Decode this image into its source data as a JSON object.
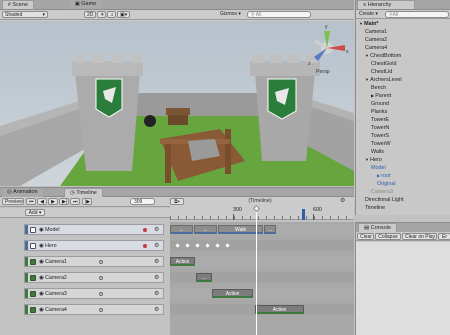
{
  "scene_panel": {
    "tabs": [
      "Scene",
      "Game"
    ],
    "shading_mode": "Shaded",
    "mode_2d": "2D",
    "gizmos_label": "Gizmos",
    "search_placeholder": "All",
    "persp_label": "Persp",
    "gizmo_axes": [
      "y",
      "x",
      "z"
    ]
  },
  "hierarchy": {
    "tab": "Hierarchy",
    "create_label": "Create",
    "search_placeholder": "All",
    "items": [
      {
        "label": "Main*",
        "depth": 0,
        "arrow": "▼",
        "color": "#1e1e1e",
        "bold": true
      },
      {
        "label": "Camera1",
        "depth": 1,
        "arrow": "",
        "color": "#1e1e1e"
      },
      {
        "label": "Camera2",
        "depth": 1,
        "arrow": "",
        "color": "#1e1e1e"
      },
      {
        "label": "Camera4",
        "depth": 1,
        "arrow": "",
        "color": "#1e1e1e"
      },
      {
        "label": "ChestBottom",
        "depth": 1,
        "arrow": "▼",
        "color": "#1e1e1e"
      },
      {
        "label": "ChestGold",
        "depth": 2,
        "arrow": "",
        "color": "#1e1e1e"
      },
      {
        "label": "ChestLid",
        "depth": 2,
        "arrow": "",
        "color": "#1e1e1e"
      },
      {
        "label": "ArchersLevel",
        "depth": 1,
        "arrow": "▼",
        "color": "#1e1e1e"
      },
      {
        "label": "Bench",
        "depth": 2,
        "arrow": "",
        "color": "#1e1e1e"
      },
      {
        "label": "Parent",
        "depth": 2,
        "arrow": "▶",
        "color": "#1e1e1e"
      },
      {
        "label": "Ground",
        "depth": 2,
        "arrow": "",
        "color": "#1e1e1e"
      },
      {
        "label": "Planks",
        "depth": 2,
        "arrow": "",
        "color": "#1e1e1e"
      },
      {
        "label": "TowerE",
        "depth": 2,
        "arrow": "",
        "color": "#1e1e1e"
      },
      {
        "label": "TowerN",
        "depth": 2,
        "arrow": "",
        "color": "#1e1e1e"
      },
      {
        "label": "TowerS",
        "depth": 2,
        "arrow": "",
        "color": "#1e1e1e"
      },
      {
        "label": "TowerW",
        "depth": 2,
        "arrow": "",
        "color": "#1e1e1e"
      },
      {
        "label": "Walls",
        "depth": 2,
        "arrow": "",
        "color": "#1e1e1e"
      },
      {
        "label": "Hero",
        "depth": 1,
        "arrow": "▼",
        "color": "#1e1e1e"
      },
      {
        "label": "Model",
        "depth": 2,
        "arrow": "",
        "color": "#2f5da8"
      },
      {
        "label": "root",
        "depth": 3,
        "arrow": "▶",
        "color": "#2f5da8"
      },
      {
        "label": "Original",
        "depth": 3,
        "arrow": "",
        "color": "#2f5da8"
      },
      {
        "label": "Camera3",
        "depth": 2,
        "arrow": "",
        "color": "#8a8a8a"
      },
      {
        "label": "Directional Light",
        "depth": 1,
        "arrow": "",
        "color": "#1e1e1e"
      },
      {
        "label": "Timeline",
        "depth": 1,
        "arrow": "",
        "color": "#1e1e1e"
      }
    ]
  },
  "timeline_panel": {
    "tabs": [
      "Animation",
      "Timeline"
    ],
    "preview_label": "Preview",
    "frame_value": "309",
    "timeline_name": "(Timeline)",
    "add_label": "Add",
    "ruler_labels": [
      "300",
      "600"
    ],
    "tracks": [
      {
        "name": "Model",
        "kind": "anim",
        "strip": "#4b6d9c",
        "dot": "#c43b3b"
      },
      {
        "name": "Hero",
        "kind": "anim",
        "strip": "#4b6d9c",
        "dot": "#c43b3b"
      },
      {
        "name": "Camera1",
        "kind": "act",
        "strip": "#3f7a3f",
        "dot": ""
      },
      {
        "name": "Camera2",
        "kind": "act",
        "strip": "#3f7a3f",
        "dot": ""
      },
      {
        "name": "Camera3",
        "kind": "act",
        "strip": "#3f7a3f",
        "dot": ""
      },
      {
        "name": "Camera4",
        "kind": "act",
        "strip": "#3f7a3f",
        "dot": ""
      }
    ],
    "clips": [
      {
        "track": 0,
        "label": "...",
        "kind": "anim",
        "start": 0.0,
        "end": 0.13
      },
      {
        "track": 0,
        "label": "...",
        "kind": "anim",
        "start": 0.13,
        "end": 0.26
      },
      {
        "track": 0,
        "label": "Walk",
        "kind": "anim",
        "start": 0.26,
        "end": 0.51
      },
      {
        "track": 0,
        "label": "...",
        "kind": "anim",
        "start": 0.51,
        "end": 0.58
      },
      {
        "track": 2,
        "label": "Active",
        "kind": "act",
        "start": 0.0,
        "end": 0.14
      },
      {
        "track": 3,
        "label": "...",
        "kind": "act",
        "start": 0.14,
        "end": 0.23
      },
      {
        "track": 4,
        "label": "Active",
        "kind": "act",
        "start": 0.23,
        "end": 0.46
      },
      {
        "track": 5,
        "label": "Active",
        "kind": "act",
        "start": 0.46,
        "end": 0.73
      }
    ]
  },
  "console": {
    "tab": "Console",
    "buttons": [
      "Clear",
      "Collapse",
      "Clear on Play",
      "Er"
    ]
  }
}
